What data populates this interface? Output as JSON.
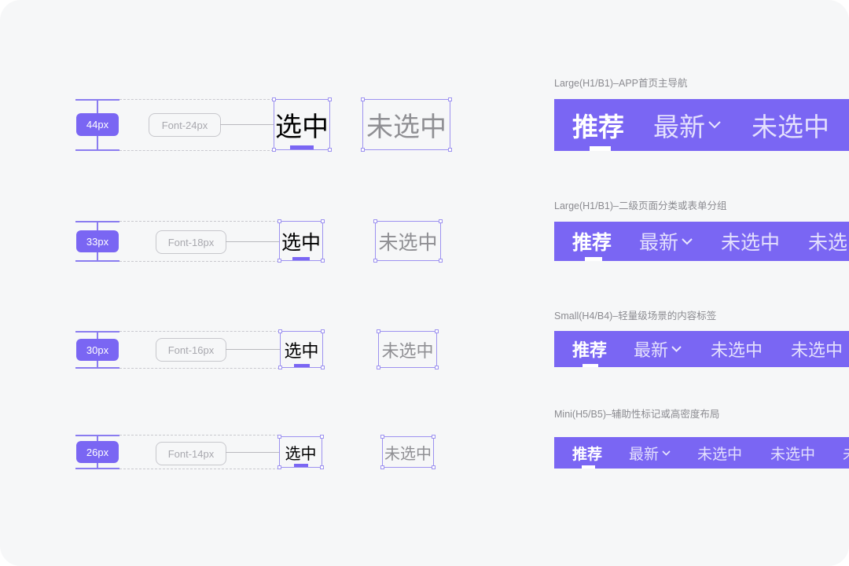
{
  "rows": [
    {
      "height_label": "44px",
      "font_label": "Font-24px",
      "selected": "选中",
      "unselected": "未选中"
    },
    {
      "height_label": "33px",
      "font_label": "Font-18px",
      "selected": "选中",
      "unselected": "未选中"
    },
    {
      "height_label": "30px",
      "font_label": "Font-16px",
      "selected": "选中",
      "unselected": "未选中"
    },
    {
      "height_label": "26px",
      "font_label": "Font-14px",
      "selected": "选中",
      "unselected": "未选中"
    }
  ],
  "variants": [
    {
      "caption": "Large(H1/B1)–APP首页主导航",
      "tabs": [
        "推荐",
        "最新",
        "未选中"
      ]
    },
    {
      "caption": "Large(H1/B1)–二级页面分类或表单分组",
      "tabs": [
        "推荐",
        "最新",
        "未选中",
        "未选"
      ]
    },
    {
      "caption": "Small(H4/B4)–轻量级场景的内容标签",
      "tabs": [
        "推荐",
        "最新",
        "未选中",
        "未选中"
      ]
    },
    {
      "caption": "Mini(H5/B5)–辅助性标记或高密度布局",
      "tabs": [
        "推荐",
        "最新",
        "未选中",
        "未选中",
        "未"
      ]
    }
  ],
  "colors": {
    "accent": "#7a66f3",
    "page_bg": "#f6f7f8"
  },
  "icons": {
    "dropdown": "chevron-down-icon"
  }
}
